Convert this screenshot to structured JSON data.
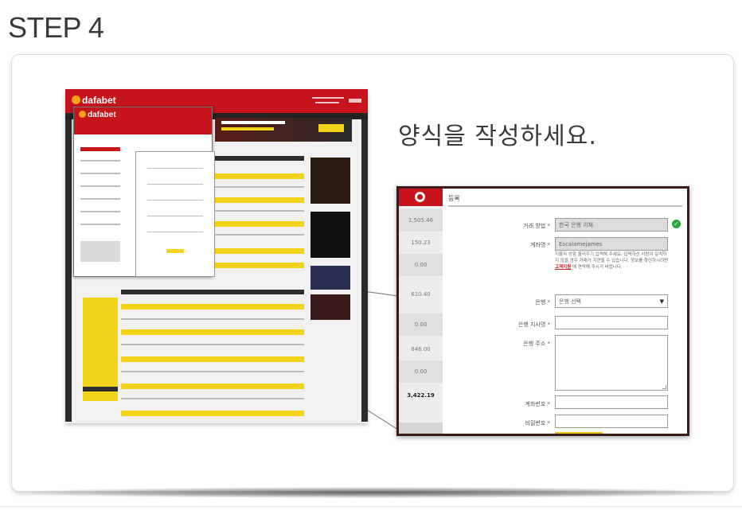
{
  "step_title": "STEP 4",
  "headline": "양식을 작성하세요.",
  "site": {
    "logo": "dafabet",
    "dialog_logo": "dafabet"
  },
  "form": {
    "title": "등록",
    "sidebar_values": [
      "1,505.46",
      "150.23",
      "0.00",
      "610.40",
      "0.00",
      "846.00",
      "0.00",
      "3,422.19"
    ],
    "fields": {
      "transaction_type": {
        "label": "거래 방법 *",
        "value": "한국 은행 이체"
      },
      "account_name": {
        "label": "계좌명 *",
        "value": "Escalamejames"
      },
      "help_text_before": "지불자 성함 불러주기 입력해 주세요. 입력하신 사람이 일치하지 않을 경우 거래가 지연될 수 있습니다. 정보를 확인하시려면",
      "help_link": "고객지원",
      "help_text_after": "에 연락해 주시기 바랍니다.",
      "bank": {
        "label": "은행 *",
        "value": "은행 선택"
      },
      "bank_branch": {
        "label": "은행 지사명 *",
        "value": ""
      },
      "bank_address": {
        "label": "은행 주소 *",
        "value": ""
      },
      "account_number": {
        "label": "계좌번호 *",
        "value": ""
      },
      "password": {
        "label": "비밀번호 *",
        "value": ""
      }
    }
  },
  "colors": {
    "brand_red": "#c7131c",
    "accent_yellow": "#f3d21a",
    "frame_dark": "#3b1a1a",
    "success_green": "#2aa63f"
  }
}
